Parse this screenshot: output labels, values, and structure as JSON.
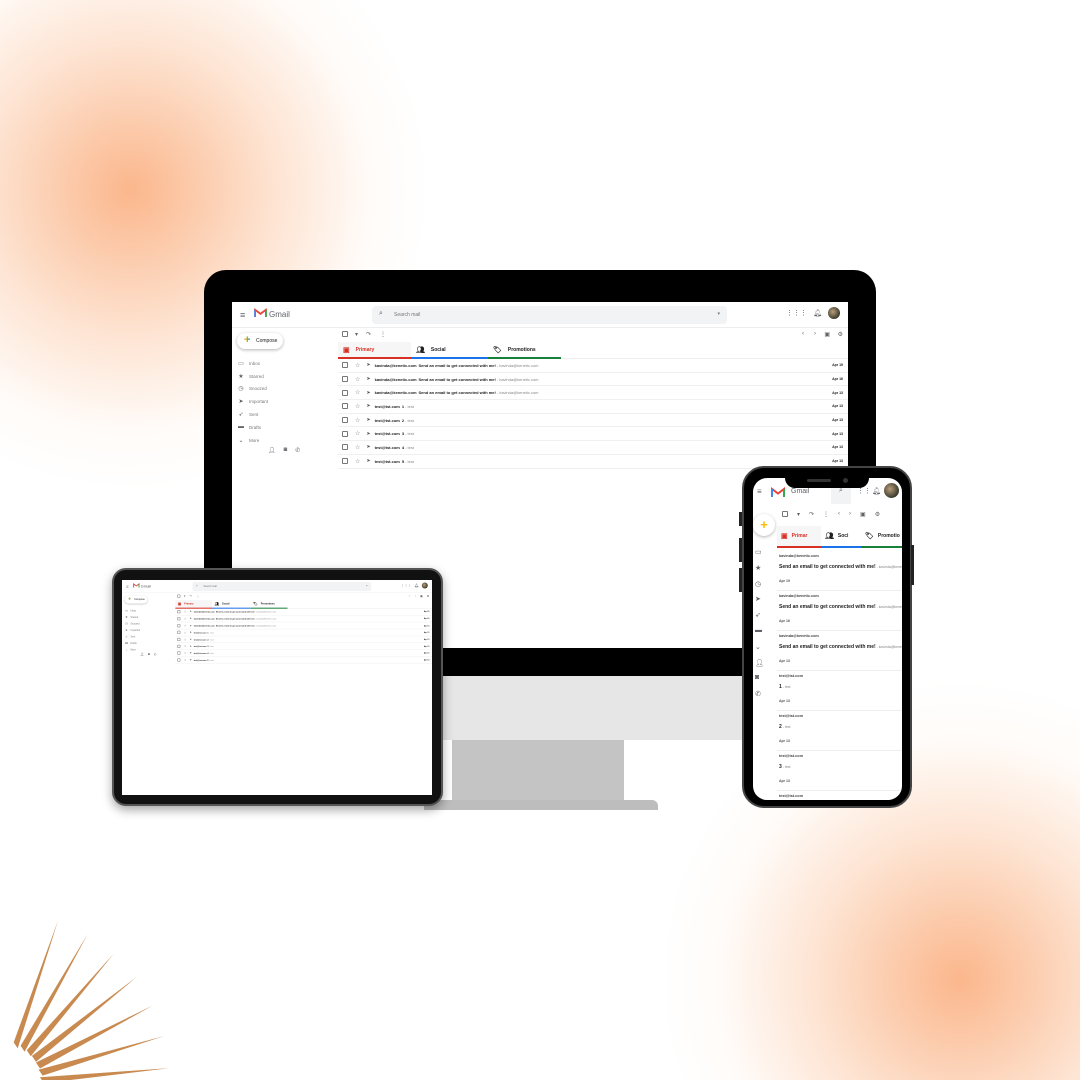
{
  "app": {
    "name": "Gmail",
    "search_placeholder": "Search mail",
    "compose_label": "Compose"
  },
  "sidebar": {
    "items": [
      {
        "label": "Inbox",
        "icon": "inbox-icon",
        "glyph": "▭"
      },
      {
        "label": "Starred",
        "icon": "star-icon",
        "glyph": "★"
      },
      {
        "label": "Snoozed",
        "icon": "clock-icon",
        "glyph": "◷"
      },
      {
        "label": "Important",
        "icon": "important-icon",
        "glyph": "➤"
      },
      {
        "label": "Sent",
        "icon": "send-icon",
        "glyph": "➶"
      },
      {
        "label": "Drafts",
        "icon": "drafts-icon",
        "glyph": "▬"
      },
      {
        "label": "More",
        "icon": "chevron-down-icon",
        "glyph": "⌄"
      }
    ]
  },
  "tabs": [
    {
      "label": "Primary",
      "icon": "inbox-icon",
      "color": "#d93025"
    },
    {
      "label": "Social",
      "icon": "people-icon",
      "color": "#1a73e8"
    },
    {
      "label": "Promotions",
      "icon": "tag-icon",
      "color": "#188038"
    }
  ],
  "phone_tabs": [
    "Primar",
    "Soci",
    "Promotio"
  ],
  "emails": [
    {
      "sender": "kavinda@kenetic.com",
      "subject": "Send an email to get connected with me!",
      "snippet": " - kavinda@kenetic.com",
      "date": "Apr 19"
    },
    {
      "sender": "kavinda@kenetic.com",
      "subject": "Send an email to get connected with me!",
      "snippet": " - kavinda@kenetic.com",
      "date": "Apr 16"
    },
    {
      "sender": "kavinda@kenetic.com",
      "subject": "Send an email to get connected with me!",
      "snippet": " - kavinda@kenetic.com",
      "date": "Apr 13"
    },
    {
      "sender": "test@tst.com",
      "subject": "1",
      "snippet": " - test",
      "date": "Apr 13"
    },
    {
      "sender": "test@tst.com",
      "subject": "2",
      "snippet": " - test",
      "date": "Apr 13"
    },
    {
      "sender": "test@tst.com",
      "subject": "3",
      "snippet": " - test",
      "date": "Apr 13"
    },
    {
      "sender": "test@tst.com",
      "subject": "4",
      "snippet": " - test",
      "date": "Apr 13"
    },
    {
      "sender": "test@tst.com",
      "subject": "5",
      "snippet": " - test",
      "date": "Apr 13"
    }
  ],
  "colors": {
    "accent_orange": "#f9a878",
    "leaf": "#c98a50"
  }
}
